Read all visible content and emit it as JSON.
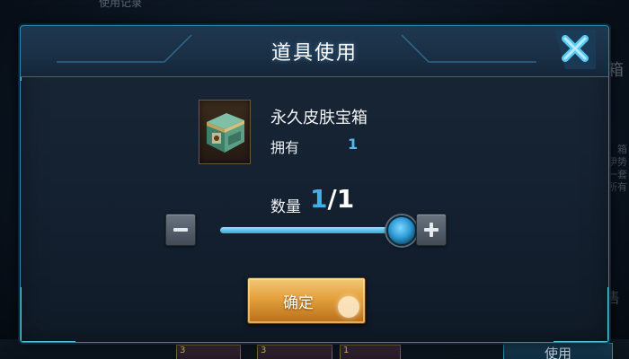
{
  "background": {
    "top_left_label": "使用记录",
    "right_label": "宝箱",
    "right_lines": [
      "一、箱",
      "选、伊势",
      "女神一套",
      "有所有"
    ],
    "bottom_right_char": "售",
    "bottom_cards": [
      {
        "count": "3"
      },
      {
        "count": "3"
      },
      {
        "count": "1"
      }
    ],
    "use_button_label": "使用"
  },
  "dialog": {
    "title": "道具使用",
    "close_icon": "close-x-icon",
    "item": {
      "icon": "treasure-chest-icon",
      "name": "永久皮肤宝箱",
      "owned_label": "拥有",
      "owned_value": "1"
    },
    "quantity": {
      "label": "数量",
      "current": "1",
      "separator": "/",
      "max": "1",
      "slider_fraction": 1.0
    },
    "minus_icon": "minus-icon",
    "plus_icon": "plus-icon",
    "confirm_label": "确定"
  },
  "colors": {
    "accent_blue": "#3fb0ea",
    "border_cyan": "#2a8aa8",
    "confirm_gold": "#e3a13c",
    "panel_dark": "#152232"
  }
}
